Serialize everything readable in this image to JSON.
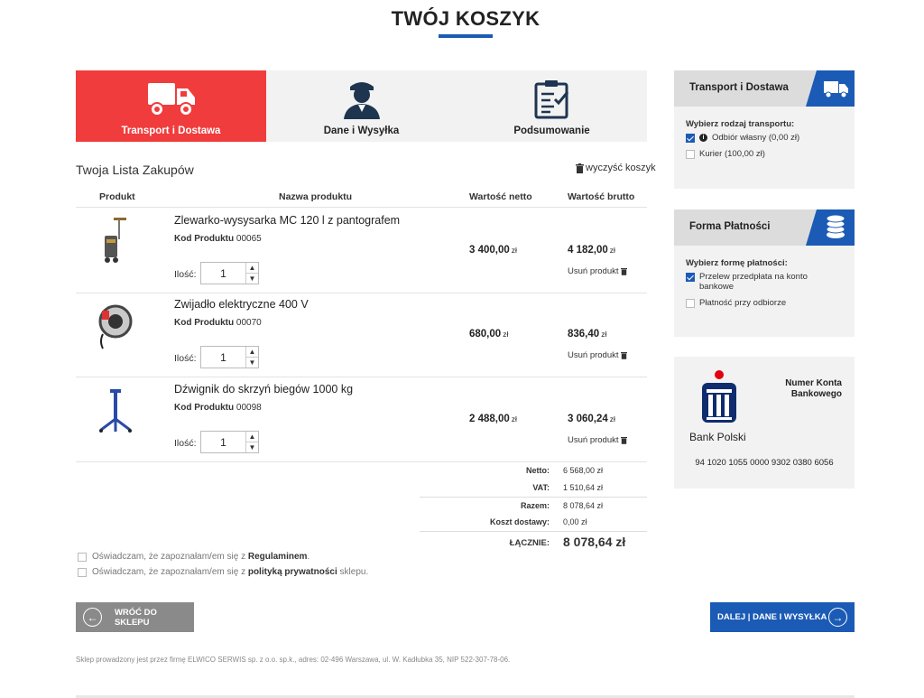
{
  "page": {
    "title": "TWÓJ KOSZYK"
  },
  "steps": [
    {
      "label": "Transport i Dostawa",
      "icon": "truck-icon",
      "active": true
    },
    {
      "label": "Dane i Wysyłka",
      "icon": "user-icon",
      "active": false
    },
    {
      "label": "Podsumowanie",
      "icon": "clipboard-icon",
      "active": false
    }
  ],
  "cart": {
    "title": "Twoja Lista Zakupów",
    "clear_label": "wyczyść koszyk",
    "headers": {
      "product": "Produkt",
      "name": "Nazwa produktu",
      "net": "Wartość netto",
      "gross": "Wartość brutto"
    },
    "code_label": "Kod Produktu",
    "qty_label": "Ilość:",
    "remove_label": "Usuń produkt",
    "currency": "zł",
    "items": [
      {
        "name": "Zlewarko-wysysarka MC 120 l z pantografem",
        "code": "00065",
        "qty": "1",
        "net": "3 400,00",
        "gross": "4 182,00"
      },
      {
        "name": "Zwijadło elektryczne 400 V",
        "code": "00070",
        "qty": "1",
        "net": "680,00",
        "gross": "836,40"
      },
      {
        "name": "Dźwignik do skrzyń biegów 1000 kg",
        "code": "00098",
        "qty": "1",
        "net": "2 488,00",
        "gross": "3 060,24"
      }
    ]
  },
  "totals": {
    "net_label": "Netto:",
    "net": "6 568,00 zł",
    "vat_label": "VAT:",
    "vat": "1 510,64 zł",
    "sum_label": "Razem:",
    "sum": "8 078,64 zł",
    "shipping_label": "Koszt dostawy:",
    "shipping": "0,00 zł",
    "total_label": "ŁĄCZNIE:",
    "total": "8 078,64 zł"
  },
  "consents": [
    {
      "pre": "Oświadczam, że zapoznałam/em się z ",
      "link": "Regulaminem",
      "post": "."
    },
    {
      "pre": "Oświadczam, że zapoznałam/em się z ",
      "link": "polityką prywatności",
      "post": " sklepu."
    }
  ],
  "buttons": {
    "back": "WRÓĆ DO SKLEPU",
    "next": "DALEJ | DANE I WYSYŁKA"
  },
  "footer": "Sklep prowadzony jest przez firmę ELWICO SERWIS sp. z o.o. sp.k., adres: 02-496 Warszawa, ul. W. Kadłubka 35, NIP 522-307-78-06.",
  "shipping_box": {
    "title": "Transport i Dostawa",
    "question": "Wybierz rodzaj transportu:",
    "options": [
      {
        "label": "Odbiór własny (0,00 zł)",
        "checked": true,
        "info": true
      },
      {
        "label": "Kurier (100,00 zł)",
        "checked": false
      }
    ]
  },
  "payment_box": {
    "title": "Forma Płatności",
    "question": "Wybierz formę płatności:",
    "options": [
      {
        "label": "Przelew przedpłata na konto bankowe",
        "checked": true
      },
      {
        "label": "Płatność przy odbiorze",
        "checked": false
      }
    ]
  },
  "bank": {
    "name": "Bank Polski",
    "account_label": "Numer Konta Bankowego",
    "account": "94 1020 1055 0000 9302 0380 6056"
  },
  "colors": {
    "accent_red": "#f03c3c",
    "brand_blue": "#1b5bb5",
    "pko_red": "#e3000f",
    "pko_navy": "#0f2d6e"
  }
}
